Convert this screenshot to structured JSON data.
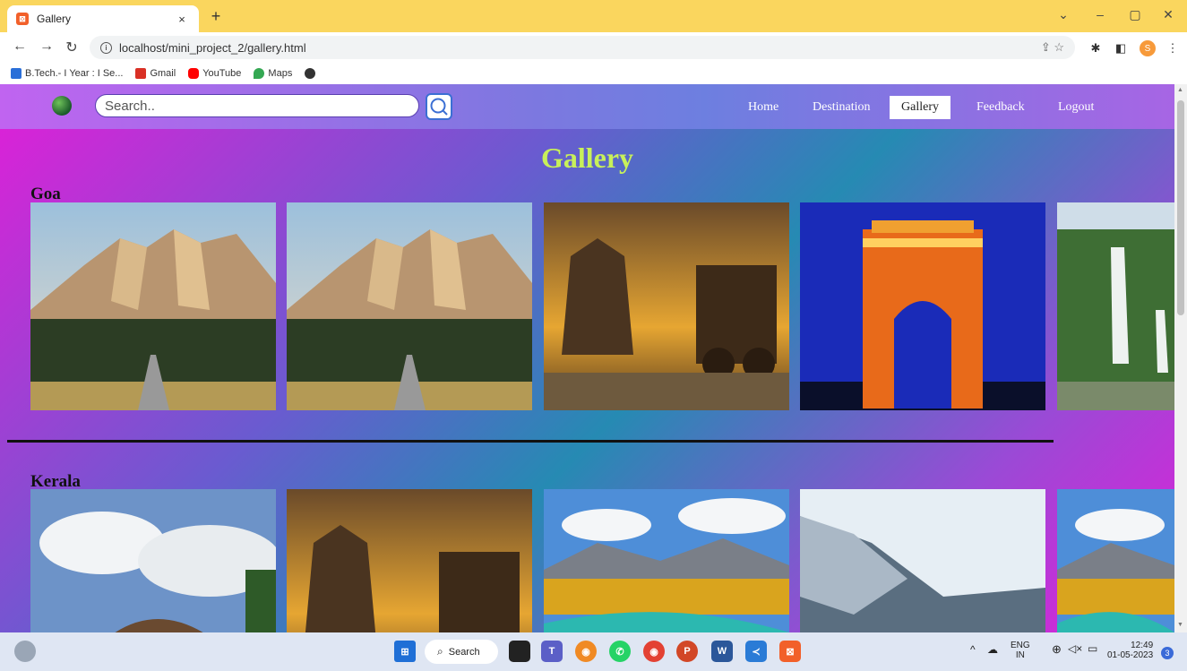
{
  "browser": {
    "tab_title": "Gallery",
    "tab_close": "×",
    "new_tab": "+",
    "url": "localhost/mini_project_2/gallery.html",
    "bookmarks": [
      {
        "label": "B.Tech.- I Year : I Se...",
        "color": "#2a6fd8"
      },
      {
        "label": "Gmail",
        "color": "#d93025"
      },
      {
        "label": "YouTube",
        "color": "#ff0000"
      },
      {
        "label": "Maps",
        "color": "#34a853"
      }
    ],
    "profile_initial": "S"
  },
  "site": {
    "search_placeholder": "Search..",
    "nav": [
      {
        "label": "Home",
        "active": false
      },
      {
        "label": "Destination",
        "active": false
      },
      {
        "label": "Gallery",
        "active": true
      },
      {
        "label": "Feedback",
        "active": false
      },
      {
        "label": "Logout",
        "active": false
      }
    ],
    "title": "Gallery",
    "sections": [
      {
        "label": "Goa"
      },
      {
        "label": "Kerala"
      }
    ]
  },
  "taskbar": {
    "search_label": "Search",
    "lang_top": "ENG",
    "lang_bottom": "IN",
    "time": "12:49",
    "date": "01-05-2023",
    "notifications": "3"
  }
}
